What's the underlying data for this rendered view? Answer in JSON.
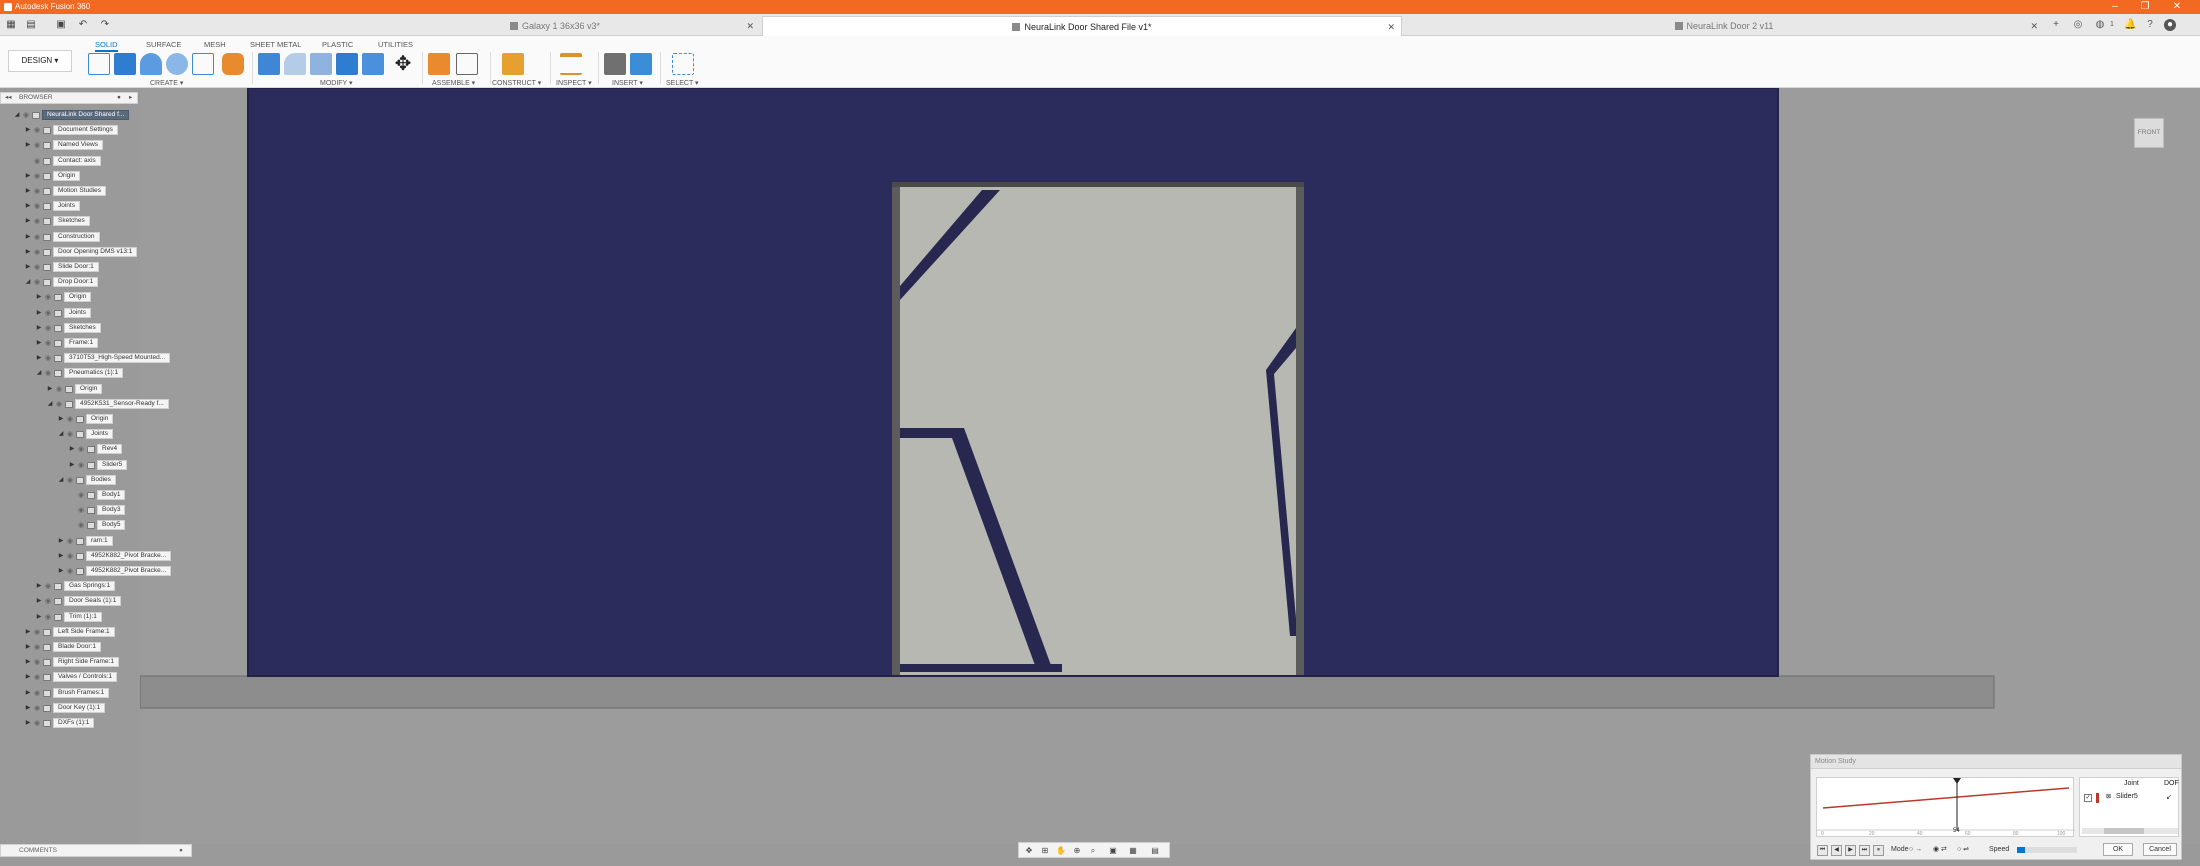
{
  "app": {
    "title": "Autodesk Fusion 360"
  },
  "tabs": [
    {
      "label": "Galaxy 1 36x36 v3*",
      "active": false
    },
    {
      "label": "NeuraLink Door Shared File v1*",
      "active": true
    },
    {
      "label": "NeuraLink Door 2 v11",
      "active": false
    }
  ],
  "right_icons": {
    "notifications_count": "1"
  },
  "toolbar": {
    "workspace": "DESIGN ▾",
    "tabs": [
      "SOLID",
      "SURFACE",
      "MESH",
      "SHEET METAL",
      "PLASTIC",
      "UTILITIES"
    ],
    "groups": [
      "CREATE ▾",
      "MODIFY ▾",
      "ASSEMBLE ▾",
      "CONSTRUCT ▾",
      "INSPECT ▾",
      "INSERT ▾",
      "SELECT ▾"
    ]
  },
  "browser": {
    "title": "BROWSER",
    "items": [
      {
        "label": "NeuraLink Door Shared f...",
        "level": 0,
        "expanded": true,
        "root": true
      },
      {
        "label": "Document Settings",
        "level": 1,
        "expanded": false
      },
      {
        "label": "Named Views",
        "level": 1,
        "expanded": false
      },
      {
        "label": "Contact: axis",
        "level": 1,
        "expanded": null
      },
      {
        "label": "Origin",
        "level": 1,
        "expanded": false
      },
      {
        "label": "Motion Studies",
        "level": 1,
        "expanded": false
      },
      {
        "label": "Joints",
        "level": 1,
        "expanded": false
      },
      {
        "label": "Sketches",
        "level": 1,
        "expanded": false
      },
      {
        "label": "Construction",
        "level": 1,
        "expanded": false
      },
      {
        "label": "Door Opening DMS v13:1",
        "level": 1,
        "expanded": false
      },
      {
        "label": "Slide Door:1",
        "level": 1,
        "expanded": false
      },
      {
        "label": "Drop Door:1",
        "level": 1,
        "expanded": true
      },
      {
        "label": "Origin",
        "level": 2,
        "expanded": false
      },
      {
        "label": "Joints",
        "level": 2,
        "expanded": false
      },
      {
        "label": "Sketches",
        "level": 2,
        "expanded": false
      },
      {
        "label": "Frame:1",
        "level": 2,
        "expanded": false
      },
      {
        "label": "3710T53_High-Speed Mounted...",
        "level": 2,
        "expanded": false
      },
      {
        "label": "Pneumatics (1):1",
        "level": 2,
        "expanded": true
      },
      {
        "label": "Origin",
        "level": 3,
        "expanded": false
      },
      {
        "label": "4952K531_Sensor-Ready f...",
        "level": 3,
        "expanded": true
      },
      {
        "label": "Origin",
        "level": 4,
        "expanded": false
      },
      {
        "label": "Joints",
        "level": 4,
        "expanded": true
      },
      {
        "label": "Rev4",
        "level": 5,
        "expanded": false
      },
      {
        "label": "Slider5",
        "level": 5,
        "expanded": false
      },
      {
        "label": "Bodies",
        "level": 4,
        "expanded": true
      },
      {
        "label": "Body1",
        "level": 5,
        "expanded": null
      },
      {
        "label": "Body3",
        "level": 5,
        "expanded": null
      },
      {
        "label": "Body5",
        "level": 5,
        "expanded": null
      },
      {
        "label": "ram:1",
        "level": 4,
        "expanded": false
      },
      {
        "label": "4952K882_Pivot Bracke...",
        "level": 4,
        "expanded": false
      },
      {
        "label": "4952K882_Pivot Bracke...",
        "level": 4,
        "expanded": false
      },
      {
        "label": "Gas Springs:1",
        "level": 2,
        "expanded": false
      },
      {
        "label": "Door Seals (1):1",
        "level": 2,
        "expanded": false
      },
      {
        "label": "Trim (1):1",
        "level": 2,
        "expanded": false
      },
      {
        "label": "Left Side Frame:1",
        "level": 1,
        "expanded": false
      },
      {
        "label": "Blade Door:1",
        "level": 1,
        "expanded": false
      },
      {
        "label": "Right Side Frame:1",
        "level": 1,
        "expanded": false
      },
      {
        "label": "Valves / Controls:1",
        "level": 1,
        "expanded": false
      },
      {
        "label": "Brush Frames:1",
        "level": 1,
        "expanded": false
      },
      {
        "label": "Door Key (1):1",
        "level": 1,
        "expanded": false
      },
      {
        "label": "DXFs (1):1",
        "level": 1,
        "expanded": false
      }
    ]
  },
  "viewcube": {
    "face": "FRONT"
  },
  "comments": {
    "title": "COMMENTS"
  },
  "motion_study": {
    "title": "Motion Study",
    "playhead": "54",
    "axis_ticks": [
      "0",
      "20",
      "40",
      "60",
      "80",
      "100"
    ],
    "table_headers": [
      "Joint",
      "DOF"
    ],
    "joint_row": "Slider5",
    "mode_label": "Mode",
    "speed_label": "Speed",
    "ok_label": "OK",
    "cancel_label": "Cancel"
  },
  "colors": {
    "titlebar": "#f26a21",
    "wall": "#2b2b5c",
    "accent": "#0a74c9",
    "motion_line": "#b83a2a"
  }
}
